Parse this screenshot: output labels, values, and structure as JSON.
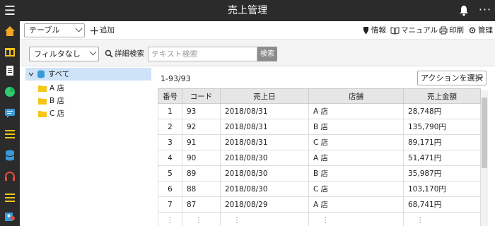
{
  "app": {
    "title": "売上管理"
  },
  "toolbar": {
    "view_select": "テーブル",
    "add_label": "追加",
    "info_label": "情報",
    "manual_label": "マニュアル",
    "print_label": "印刷",
    "admin_label": "管理"
  },
  "filter": {
    "select_value": "フィルタなし",
    "advanced_search_label": "詳細検索",
    "search_placeholder": "テキスト検索",
    "search_button": "検索"
  },
  "tree": {
    "root": "すべて",
    "children": [
      "A 店",
      "B 店",
      "C 店"
    ]
  },
  "content": {
    "record_count": "1-93/93",
    "action_select": "アクションを選択"
  },
  "table": {
    "columns": [
      "番号",
      "コード",
      "売上日",
      "店舗",
      "売上金額"
    ],
    "rows": [
      [
        "1",
        "93",
        "2018/08/31",
        "A 店",
        "28,748円"
      ],
      [
        "2",
        "92",
        "2018/08/31",
        "B 店",
        "135,790円"
      ],
      [
        "3",
        "91",
        "2018/08/31",
        "C 店",
        "89,171円"
      ],
      [
        "4",
        "90",
        "2018/08/30",
        "A 店",
        "51,471円"
      ],
      [
        "5",
        "89",
        "2018/08/30",
        "B 店",
        "35,987円"
      ],
      [
        "6",
        "88",
        "2018/08/30",
        "C 店",
        "103,170円"
      ],
      [
        "7",
        "87",
        "2018/08/29",
        "A 店",
        "68,741円"
      ]
    ],
    "ellipsis": "⋮"
  },
  "colors": {
    "titlebar": "#2b2b2b",
    "selection": "#cfe3f8",
    "header": "#e6e6e6",
    "rail_icons": [
      "#f5a623",
      "#f5c518",
      "#ffffff",
      "#2ecc71",
      "#3a9ad9",
      "#f5c518",
      "#3a9ad9",
      "#e74c3c",
      "#f5c518",
      "#3a9ad9"
    ]
  }
}
